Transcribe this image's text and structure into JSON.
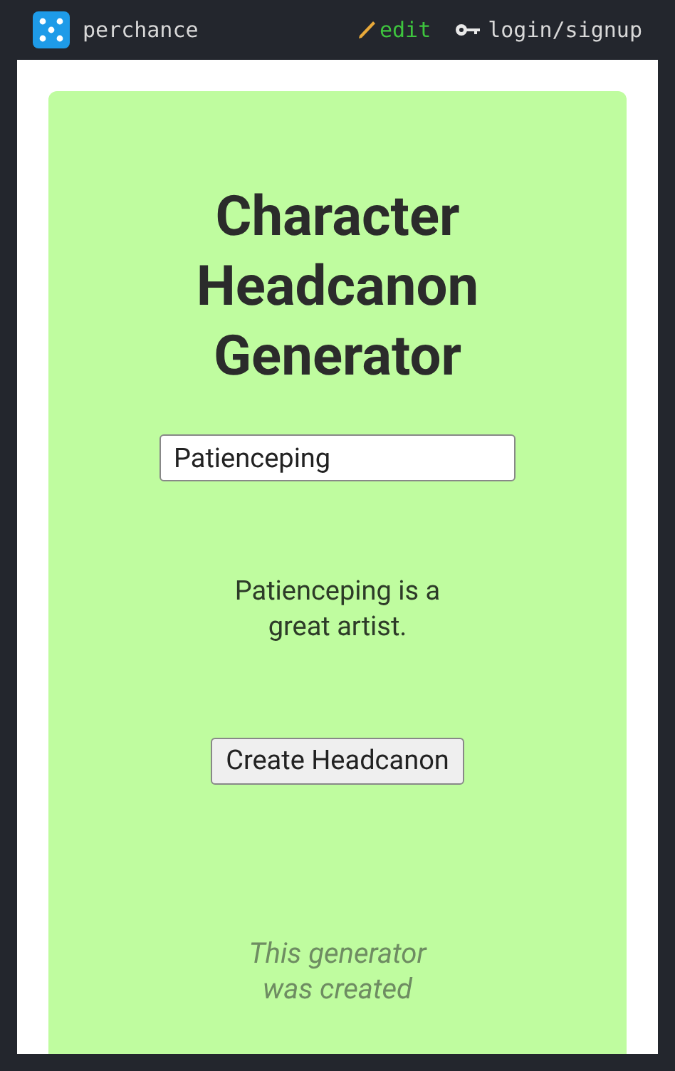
{
  "top_bar": {
    "site_name": "perchance",
    "edit_link": "edit",
    "login_link": "login/signup"
  },
  "generator": {
    "title": "Character Headcanon Generator",
    "name_field": {
      "value": "Patienceping"
    },
    "output": "Patienceping is a great artist.",
    "button": "Create Headcanon",
    "footer": "This generator was created"
  }
}
